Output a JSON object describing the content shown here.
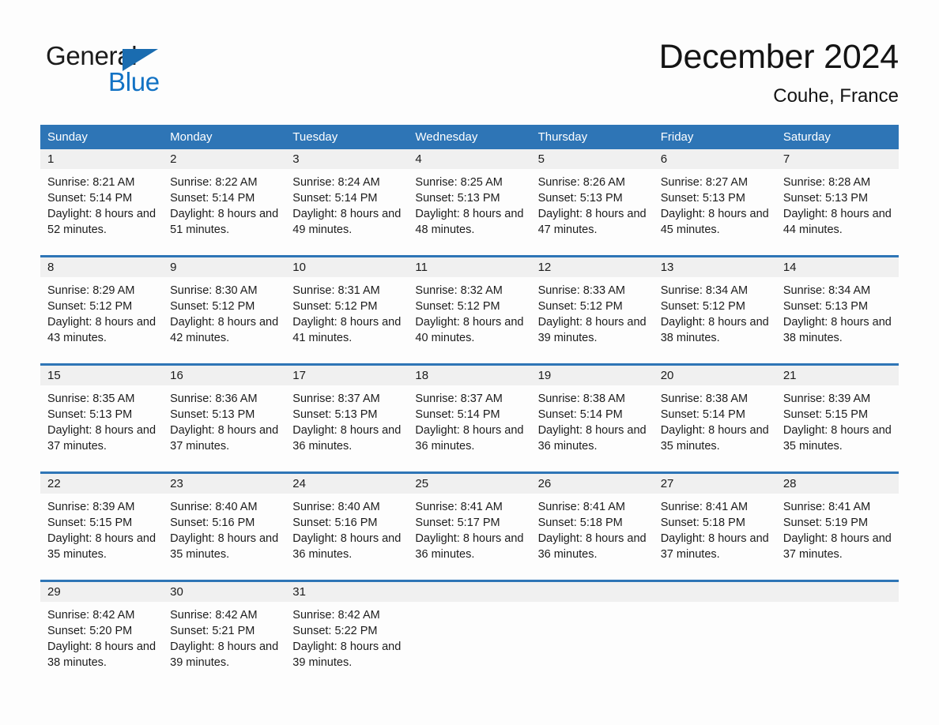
{
  "brand": {
    "name_part1": "General",
    "name_part2": "Blue",
    "logo_icon": "triangle-flag-icon"
  },
  "header": {
    "month_title": "December 2024",
    "location": "Couhe, France"
  },
  "colors": {
    "header_blue": "#2e75b6",
    "brand_blue": "#1272c4",
    "daynum_band": "#f0f0f0",
    "page_background": "#fdfdfd",
    "text": "#1c1c1c"
  },
  "weekdays": [
    "Sunday",
    "Monday",
    "Tuesday",
    "Wednesday",
    "Thursday",
    "Friday",
    "Saturday"
  ],
  "weeks": [
    {
      "days": [
        {
          "date": "1",
          "sunrise": "Sunrise: 8:21 AM",
          "sunset": "Sunset: 5:14 PM",
          "daylight": "Daylight: 8 hours and 52 minutes."
        },
        {
          "date": "2",
          "sunrise": "Sunrise: 8:22 AM",
          "sunset": "Sunset: 5:14 PM",
          "daylight": "Daylight: 8 hours and 51 minutes."
        },
        {
          "date": "3",
          "sunrise": "Sunrise: 8:24 AM",
          "sunset": "Sunset: 5:14 PM",
          "daylight": "Daylight: 8 hours and 49 minutes."
        },
        {
          "date": "4",
          "sunrise": "Sunrise: 8:25 AM",
          "sunset": "Sunset: 5:13 PM",
          "daylight": "Daylight: 8 hours and 48 minutes."
        },
        {
          "date": "5",
          "sunrise": "Sunrise: 8:26 AM",
          "sunset": "Sunset: 5:13 PM",
          "daylight": "Daylight: 8 hours and 47 minutes."
        },
        {
          "date": "6",
          "sunrise": "Sunrise: 8:27 AM",
          "sunset": "Sunset: 5:13 PM",
          "daylight": "Daylight: 8 hours and 45 minutes."
        },
        {
          "date": "7",
          "sunrise": "Sunrise: 8:28 AM",
          "sunset": "Sunset: 5:13 PM",
          "daylight": "Daylight: 8 hours and 44 minutes."
        }
      ]
    },
    {
      "days": [
        {
          "date": "8",
          "sunrise": "Sunrise: 8:29 AM",
          "sunset": "Sunset: 5:12 PM",
          "daylight": "Daylight: 8 hours and 43 minutes."
        },
        {
          "date": "9",
          "sunrise": "Sunrise: 8:30 AM",
          "sunset": "Sunset: 5:12 PM",
          "daylight": "Daylight: 8 hours and 42 minutes."
        },
        {
          "date": "10",
          "sunrise": "Sunrise: 8:31 AM",
          "sunset": "Sunset: 5:12 PM",
          "daylight": "Daylight: 8 hours and 41 minutes."
        },
        {
          "date": "11",
          "sunrise": "Sunrise: 8:32 AM",
          "sunset": "Sunset: 5:12 PM",
          "daylight": "Daylight: 8 hours and 40 minutes."
        },
        {
          "date": "12",
          "sunrise": "Sunrise: 8:33 AM",
          "sunset": "Sunset: 5:12 PM",
          "daylight": "Daylight: 8 hours and 39 minutes."
        },
        {
          "date": "13",
          "sunrise": "Sunrise: 8:34 AM",
          "sunset": "Sunset: 5:12 PM",
          "daylight": "Daylight: 8 hours and 38 minutes."
        },
        {
          "date": "14",
          "sunrise": "Sunrise: 8:34 AM",
          "sunset": "Sunset: 5:13 PM",
          "daylight": "Daylight: 8 hours and 38 minutes."
        }
      ]
    },
    {
      "days": [
        {
          "date": "15",
          "sunrise": "Sunrise: 8:35 AM",
          "sunset": "Sunset: 5:13 PM",
          "daylight": "Daylight: 8 hours and 37 minutes."
        },
        {
          "date": "16",
          "sunrise": "Sunrise: 8:36 AM",
          "sunset": "Sunset: 5:13 PM",
          "daylight": "Daylight: 8 hours and 37 minutes."
        },
        {
          "date": "17",
          "sunrise": "Sunrise: 8:37 AM",
          "sunset": "Sunset: 5:13 PM",
          "daylight": "Daylight: 8 hours and 36 minutes."
        },
        {
          "date": "18",
          "sunrise": "Sunrise: 8:37 AM",
          "sunset": "Sunset: 5:14 PM",
          "daylight": "Daylight: 8 hours and 36 minutes."
        },
        {
          "date": "19",
          "sunrise": "Sunrise: 8:38 AM",
          "sunset": "Sunset: 5:14 PM",
          "daylight": "Daylight: 8 hours and 36 minutes."
        },
        {
          "date": "20",
          "sunrise": "Sunrise: 8:38 AM",
          "sunset": "Sunset: 5:14 PM",
          "daylight": "Daylight: 8 hours and 35 minutes."
        },
        {
          "date": "21",
          "sunrise": "Sunrise: 8:39 AM",
          "sunset": "Sunset: 5:15 PM",
          "daylight": "Daylight: 8 hours and 35 minutes."
        }
      ]
    },
    {
      "days": [
        {
          "date": "22",
          "sunrise": "Sunrise: 8:39 AM",
          "sunset": "Sunset: 5:15 PM",
          "daylight": "Daylight: 8 hours and 35 minutes."
        },
        {
          "date": "23",
          "sunrise": "Sunrise: 8:40 AM",
          "sunset": "Sunset: 5:16 PM",
          "daylight": "Daylight: 8 hours and 35 minutes."
        },
        {
          "date": "24",
          "sunrise": "Sunrise: 8:40 AM",
          "sunset": "Sunset: 5:16 PM",
          "daylight": "Daylight: 8 hours and 36 minutes."
        },
        {
          "date": "25",
          "sunrise": "Sunrise: 8:41 AM",
          "sunset": "Sunset: 5:17 PM",
          "daylight": "Daylight: 8 hours and 36 minutes."
        },
        {
          "date": "26",
          "sunrise": "Sunrise: 8:41 AM",
          "sunset": "Sunset: 5:18 PM",
          "daylight": "Daylight: 8 hours and 36 minutes."
        },
        {
          "date": "27",
          "sunrise": "Sunrise: 8:41 AM",
          "sunset": "Sunset: 5:18 PM",
          "daylight": "Daylight: 8 hours and 37 minutes."
        },
        {
          "date": "28",
          "sunrise": "Sunrise: 8:41 AM",
          "sunset": "Sunset: 5:19 PM",
          "daylight": "Daylight: 8 hours and 37 minutes."
        }
      ]
    },
    {
      "days": [
        {
          "date": "29",
          "sunrise": "Sunrise: 8:42 AM",
          "sunset": "Sunset: 5:20 PM",
          "daylight": "Daylight: 8 hours and 38 minutes."
        },
        {
          "date": "30",
          "sunrise": "Sunrise: 8:42 AM",
          "sunset": "Sunset: 5:21 PM",
          "daylight": "Daylight: 8 hours and 39 minutes."
        },
        {
          "date": "31",
          "sunrise": "Sunrise: 8:42 AM",
          "sunset": "Sunset: 5:22 PM",
          "daylight": "Daylight: 8 hours and 39 minutes."
        },
        {
          "date": "",
          "sunrise": "",
          "sunset": "",
          "daylight": ""
        },
        {
          "date": "",
          "sunrise": "",
          "sunset": "",
          "daylight": ""
        },
        {
          "date": "",
          "sunrise": "",
          "sunset": "",
          "daylight": ""
        },
        {
          "date": "",
          "sunrise": "",
          "sunset": "",
          "daylight": ""
        }
      ]
    }
  ]
}
